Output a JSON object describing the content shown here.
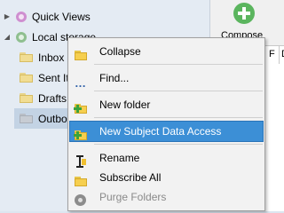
{
  "tree": {
    "accounts": [
      {
        "label": "Quick Views",
        "expander": "▶",
        "icon": "quick-views-icon"
      },
      {
        "label": "Local storage",
        "expander": "◢",
        "icon": "local-storage-icon"
      }
    ],
    "folders": [
      {
        "label": "Inbox",
        "icon": "folder-icon"
      },
      {
        "label": "Sent It",
        "icon": "folder-icon"
      },
      {
        "label": "Drafts",
        "icon": "folder-icon"
      },
      {
        "label": "Outbo",
        "icon": "outbox-folder-icon"
      }
    ]
  },
  "toolbar": {
    "compose_label": "Compose"
  },
  "message_list": {
    "columns": [
      "F",
      "D"
    ]
  },
  "context_menu": {
    "items": [
      {
        "label": "Collapse",
        "icon": "folder-icon",
        "enabled": true
      },
      {
        "label": "Find...",
        "icon": "find-icon",
        "enabled": true
      },
      {
        "label": "New folder",
        "icon": "new-folder-icon",
        "enabled": true
      },
      {
        "label": "New Subject Data Access",
        "icon": "new-folder-icon",
        "enabled": true,
        "highlighted": true
      },
      {
        "label": "Rename",
        "icon": "rename-cursor-icon",
        "enabled": true
      },
      {
        "label": "Subscribe All",
        "icon": "folder-icon",
        "enabled": true
      },
      {
        "label": "Purge Folders",
        "icon": "purge-icon",
        "enabled": false
      }
    ]
  },
  "colors": {
    "highlight": "#3c8fd6",
    "compose_green": "#5bb55e",
    "tree_background": "#e4ebf3",
    "disabled_text": "#8a8a8a"
  }
}
